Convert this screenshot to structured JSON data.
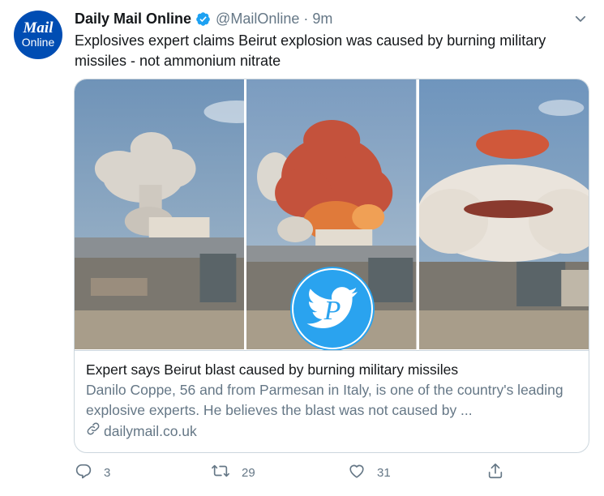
{
  "tweet": {
    "author_name": "Daily Mail Online",
    "handle": "@MailOnline",
    "separator": "·",
    "time": "9m",
    "avatar": {
      "line1": "Mail",
      "line2": "Online"
    },
    "text": "Explosives expert claims Beirut explosion was caused by burning military missiles - not ammonium nitrate"
  },
  "card": {
    "title": "Expert says Beirut blast caused by burning military missiles",
    "description": "Danilo Coppe, 56 and from Parmesan in Italy, is one of the country's leading explosive experts. He believes the blast was not caused by ...",
    "domain": "dailymail.co.uk"
  },
  "actions": {
    "reply_count": "3",
    "retweet_count": "29",
    "like_count": "31"
  },
  "colors": {
    "verified": "#1da1f2",
    "avatar_bg": "#004db3",
    "secondary_text": "#657786",
    "border": "#ccd6dd"
  },
  "icons": [
    "verified-icon",
    "chevron-down-icon",
    "link-icon",
    "reply-icon",
    "retweet-icon",
    "like-icon",
    "share-icon",
    "twitter-bird-logo"
  ]
}
